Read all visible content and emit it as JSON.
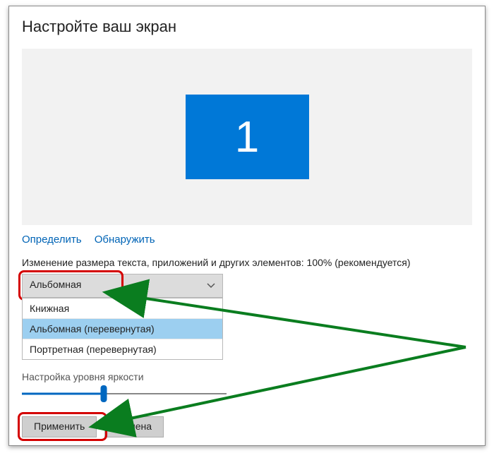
{
  "title": "Настройте ваш экран",
  "monitor": {
    "number": "1"
  },
  "links": {
    "identify": "Определить",
    "detect": "Обнаружить"
  },
  "scale_label": "Изменение размера текста, приложений и других элементов: 100% (рекомендуется)",
  "orientation": {
    "selected": "Альбомная",
    "options": [
      "Книжная",
      "Альбомная (перевернутая)",
      "Портретная (перевернутая)"
    ],
    "highlighted_index": 1
  },
  "brightness": {
    "label": "Настройка уровня яркости",
    "percent": 40
  },
  "buttons": {
    "apply": "Применить",
    "cancel": "Отмена"
  }
}
